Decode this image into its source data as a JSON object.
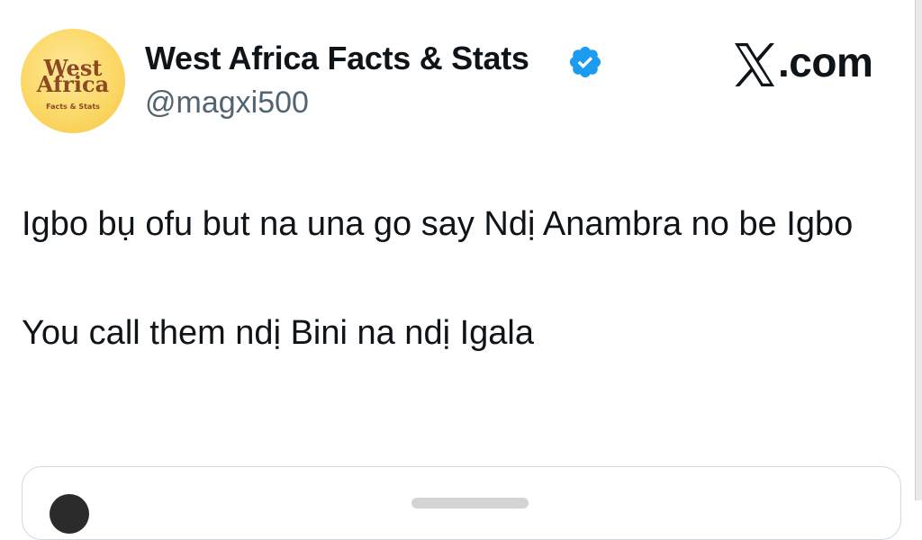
{
  "tweet": {
    "author": {
      "display_name": "West Africa Facts & Stats",
      "handle": "@magxi500",
      "verified": true,
      "avatar": {
        "line1": "West",
        "line2": "Africa",
        "tagline": "Facts & Stats"
      }
    },
    "brand": {
      "icon": "x-logo-icon",
      "label": ".com"
    },
    "text": {
      "line1": "Igbo bụ ofu but na una go say Ndị Anambra no be Igbo",
      "line2": "You call them ndị Bini na ndị Igala"
    }
  },
  "colors": {
    "text": "#0f1419",
    "secondary": "#536471",
    "verified": "#1d9bf0",
    "avatar_bg": "#fbd867",
    "avatar_text": "#8b4a22",
    "border": "#cfd9de"
  }
}
